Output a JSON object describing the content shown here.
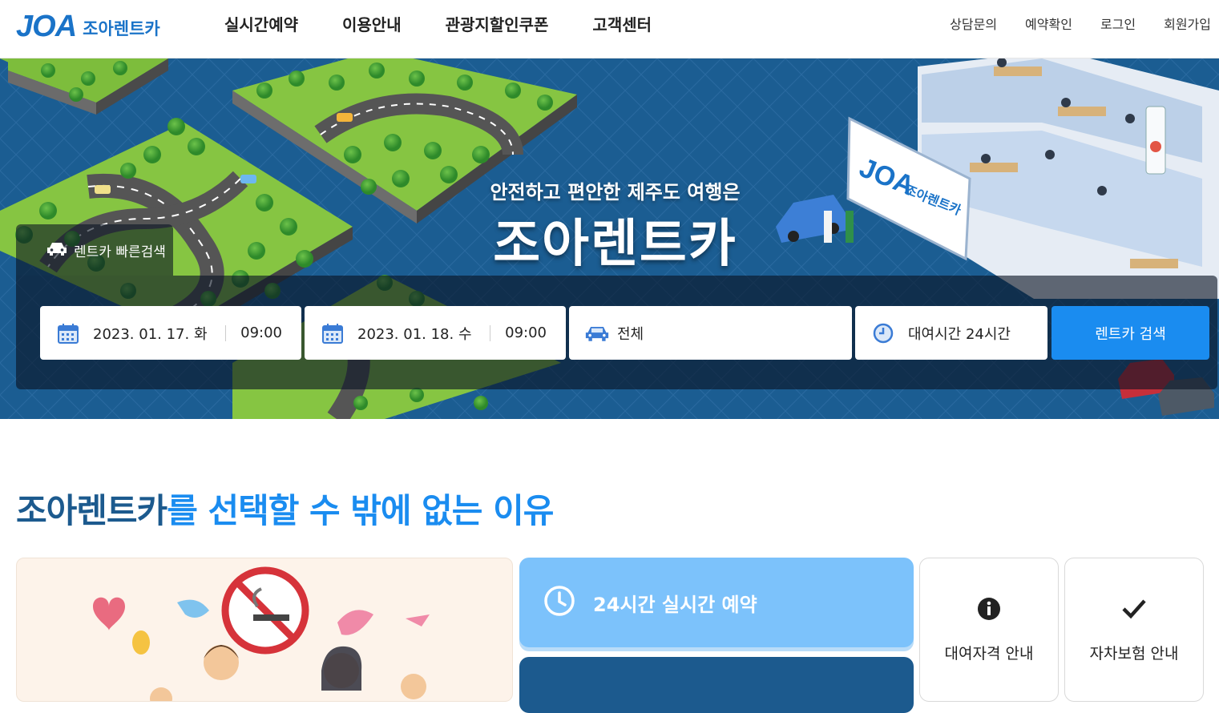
{
  "header": {
    "logo_main": "JOA",
    "logo_sub": "조아렌트카",
    "nav": [
      "실시간예약",
      "이용안내",
      "관광지할인쿠폰",
      "고객센터"
    ],
    "util": [
      "상담문의",
      "예약확인",
      "로그인",
      "회원가입"
    ]
  },
  "hero": {
    "subtitle": "안전하고 편안한 제주도 여행은",
    "title": "조아렌트카",
    "sign_text": "JOA 조아렌트카"
  },
  "quick_search": {
    "tab_label": "렌트카 빠른검색",
    "pickup_date": "2023. 01. 17. 화",
    "pickup_time": "09:00",
    "return_date": "2023. 01. 18. 수",
    "return_time": "09:00",
    "car_type": "전체",
    "rental_duration": "대여시간 24시간",
    "search_label": "렌트카 검색"
  },
  "section": {
    "title_dark": "조아렌트카",
    "title_light": "를 선택할 수 밖에 없는 이유"
  },
  "cards": {
    "realtime_label": "24시간 실시간 예약",
    "qualification_label": "대여자격 안내",
    "insurance_label": "자차보험 안내"
  },
  "colors": {
    "brand_blue": "#1a73c8",
    "accent_blue": "#1a8cf0",
    "navy": "#1c5a8e",
    "light_blue": "#7cc2fb"
  }
}
